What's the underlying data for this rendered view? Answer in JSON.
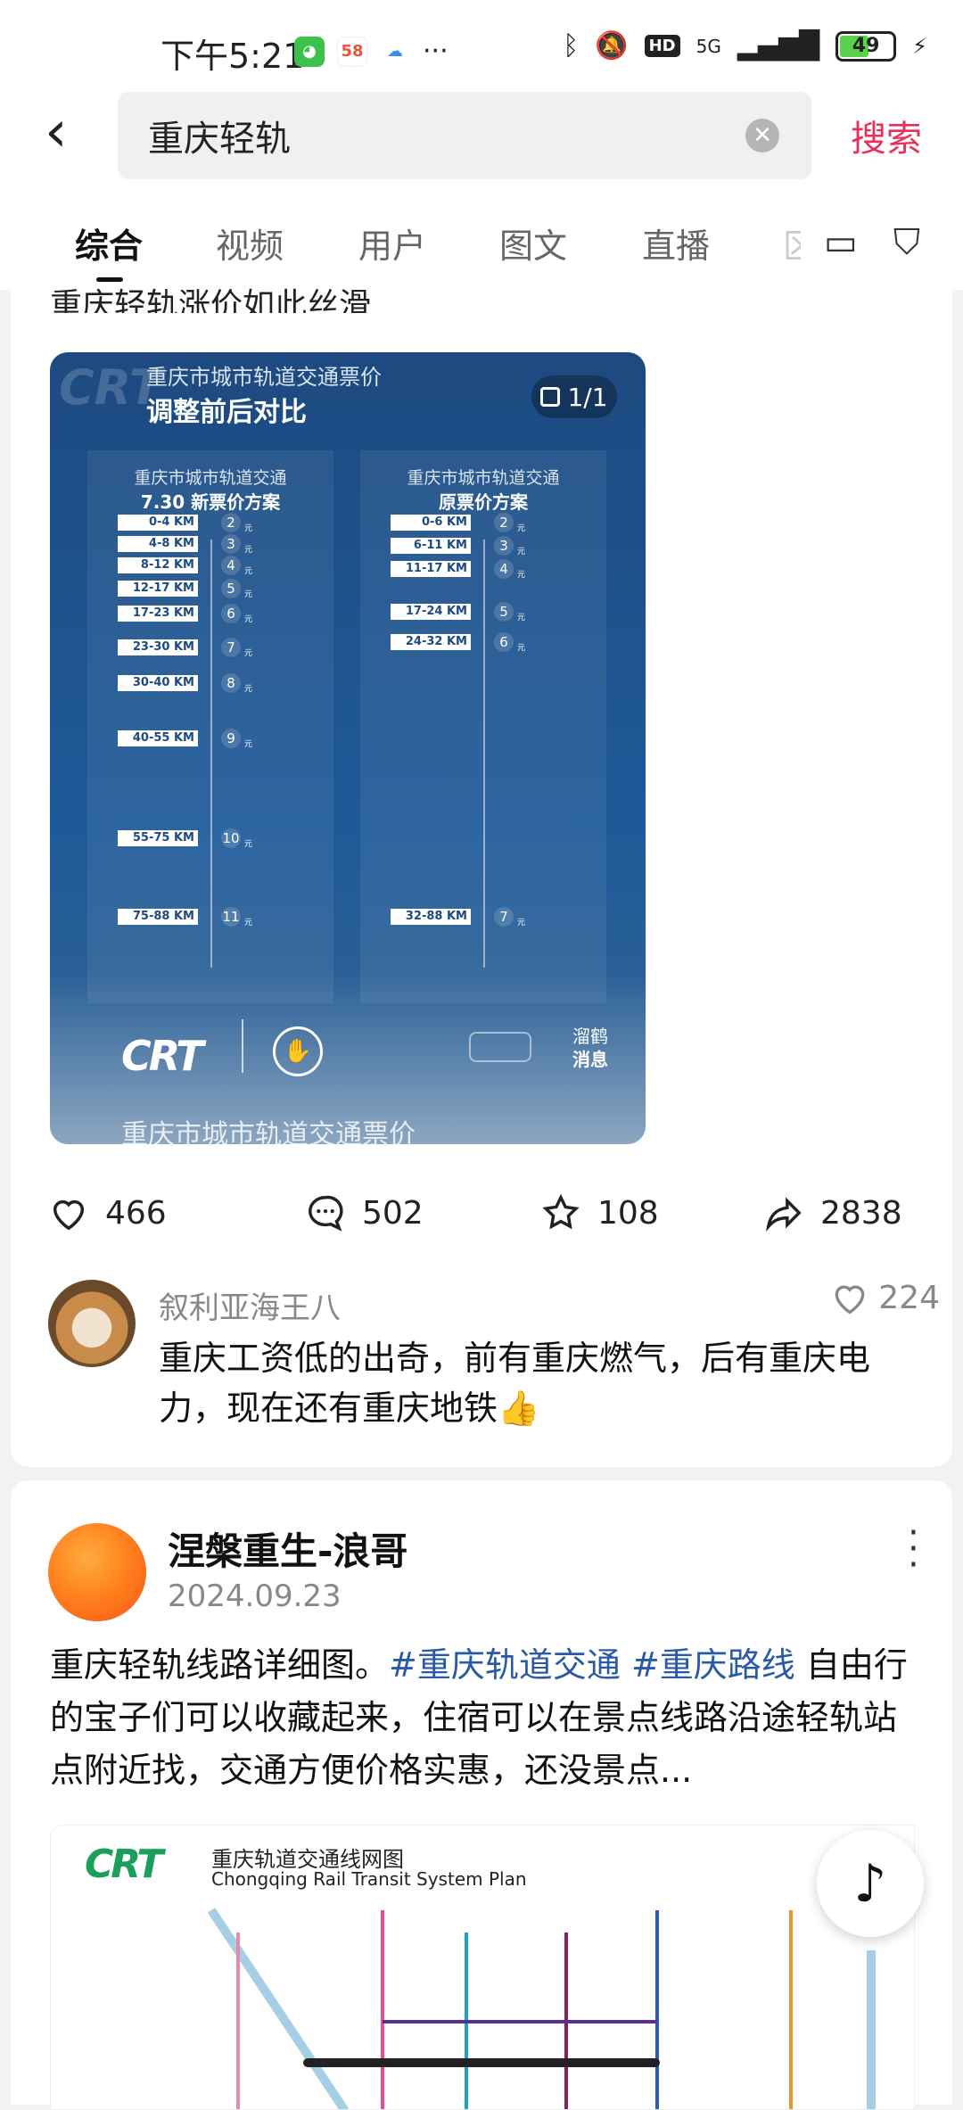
{
  "status_bar": {
    "time": "下午5:21",
    "network": "5G",
    "battery": "49",
    "hd": "HD"
  },
  "search": {
    "query": "重庆轻轨",
    "button": "搜索"
  },
  "tabs": [
    {
      "label": "综合"
    },
    {
      "label": "视频"
    },
    {
      "label": "用户"
    },
    {
      "label": "图文"
    },
    {
      "label": "直播"
    },
    {
      "label": "区"
    }
  ],
  "post1": {
    "title_partial": "重庆轻轨涨价如此丝滑",
    "image": {
      "header_line1": "重庆市城市轨道交通票价",
      "header_line2": "调整前后对比",
      "counter": "1/1",
      "watermark": "消息",
      "left_panel": {
        "title1": "重庆市城市轨道交通",
        "title2": "7.30 新票价方案",
        "rows": [
          {
            "km": "0-4 KM",
            "price": "2"
          },
          {
            "km": "4-8 KM",
            "price": "3"
          },
          {
            "km": "8-12 KM",
            "price": "4"
          },
          {
            "km": "12-17 KM",
            "price": "5"
          },
          {
            "km": "17-23 KM",
            "price": "6"
          },
          {
            "km": "23-30 KM",
            "price": "7"
          },
          {
            "km": "30-40 KM",
            "price": "8"
          },
          {
            "km": "40-55 KM",
            "price": "9"
          },
          {
            "km": "55-75 KM",
            "price": "10"
          },
          {
            "km": "75-88 KM",
            "price": "11"
          }
        ]
      },
      "right_panel": {
        "title1": "重庆市城市轨道交通",
        "title2": "原票价方案",
        "rows": [
          {
            "km": "0-6 KM",
            "price": "2"
          },
          {
            "km": "6-11 KM",
            "price": "3"
          },
          {
            "km": "11-17 KM",
            "price": "4"
          },
          {
            "km": "17-24 KM",
            "price": "5"
          },
          {
            "km": "24-32 KM",
            "price": "6"
          },
          {
            "km": "32-88 KM",
            "price": "7"
          }
        ]
      },
      "yuan": "元",
      "footer_right1": "溜鹤",
      "footer_right2": "消息",
      "footer_cut_text": "重庆市城市轨道交通票价"
    },
    "likes": "466",
    "comments": "502",
    "favorites": "108",
    "shares": "2838",
    "top_comment": {
      "user": "叙利亚海王八",
      "likes": "224",
      "text": "重庆工资低的出奇，前有重庆燃气，后有重庆电力，现在还有重庆地铁👍"
    }
  },
  "post2": {
    "author": "涅槃重生-浪哥",
    "date": "2024.09.23",
    "text_before": "重庆轻轨线路详细图。",
    "tag1": "#重庆轨道交通",
    "tag2": "#重庆路线",
    "text_after": " 自由行的宝子们可以收藏起来，住宿可以在景点线路沿途轻轨站点附近找，交通方便价格实惠，还没景点...",
    "map_title": "重庆轨道交通线网图",
    "map_subtitle": "Chongqing Rail Transit System Plan"
  },
  "colors": {
    "accent": "#e8305a",
    "tag": "#2a5aa6"
  }
}
